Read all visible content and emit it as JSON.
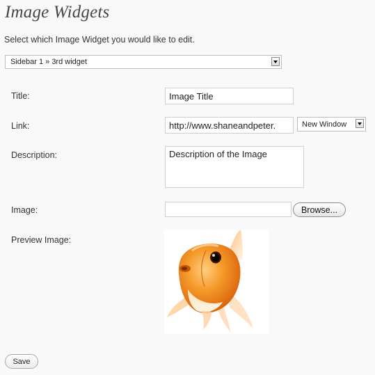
{
  "header": {
    "title": "Image Widgets"
  },
  "intro": "Select which Image Widget you would like to edit.",
  "widget_select": {
    "selected": "Sidebar 1 » 3rd widget"
  },
  "form": {
    "title_label": "Title:",
    "title_value": "Image Title",
    "link_label": "Link:",
    "link_value": "http://www.shaneandpeter.",
    "link_target_selected": "New Window",
    "description_label": "Description:",
    "description_value": "Description of the Image",
    "image_label": "Image:",
    "image_value": "",
    "browse_label": "Browse...",
    "preview_label": "Preview Image:",
    "preview_icon": "goldfish-image"
  },
  "footer": {
    "save_label": "Save"
  },
  "colors": {
    "background": "#f9f9f9",
    "title": "#464646",
    "input_border": "#cfcfcf",
    "fish_orange": "#f08a1c"
  }
}
